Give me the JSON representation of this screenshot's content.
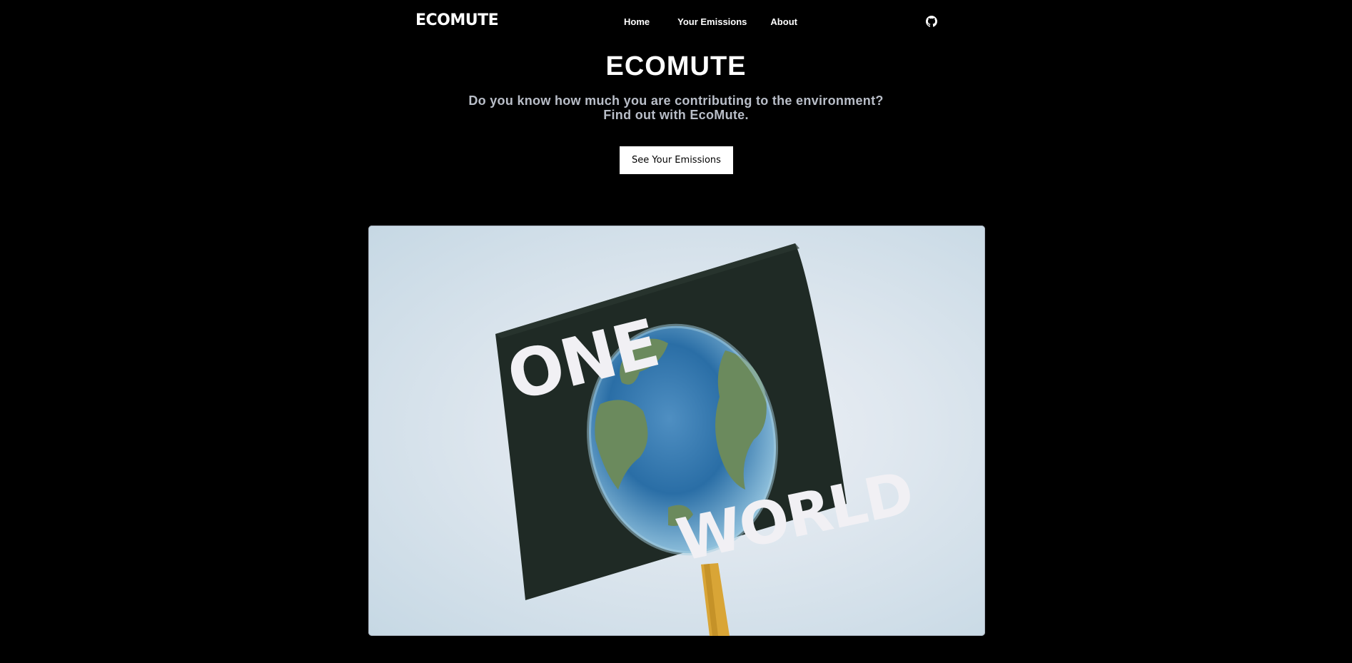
{
  "navbar": {
    "brand": "ECOMUTE",
    "links": [
      {
        "label": "Home"
      },
      {
        "label": "Your Emissions"
      },
      {
        "label": "About"
      }
    ],
    "github_icon": "github-icon"
  },
  "hero": {
    "title": "ECOMUTE",
    "subtitle_line1": "Do you know how much you are contributing to the environment?",
    "subtitle_line2": "Find out with EcoMute.",
    "cta_label": "See Your Emissions"
  },
  "image": {
    "sign_text_top": "ONE",
    "sign_text_bottom": "WORLD"
  },
  "colors": {
    "background": "#000000",
    "text": "#ffffff",
    "subtitle": "#b9bec8",
    "button_bg": "#ffffff",
    "button_text": "#000000"
  }
}
